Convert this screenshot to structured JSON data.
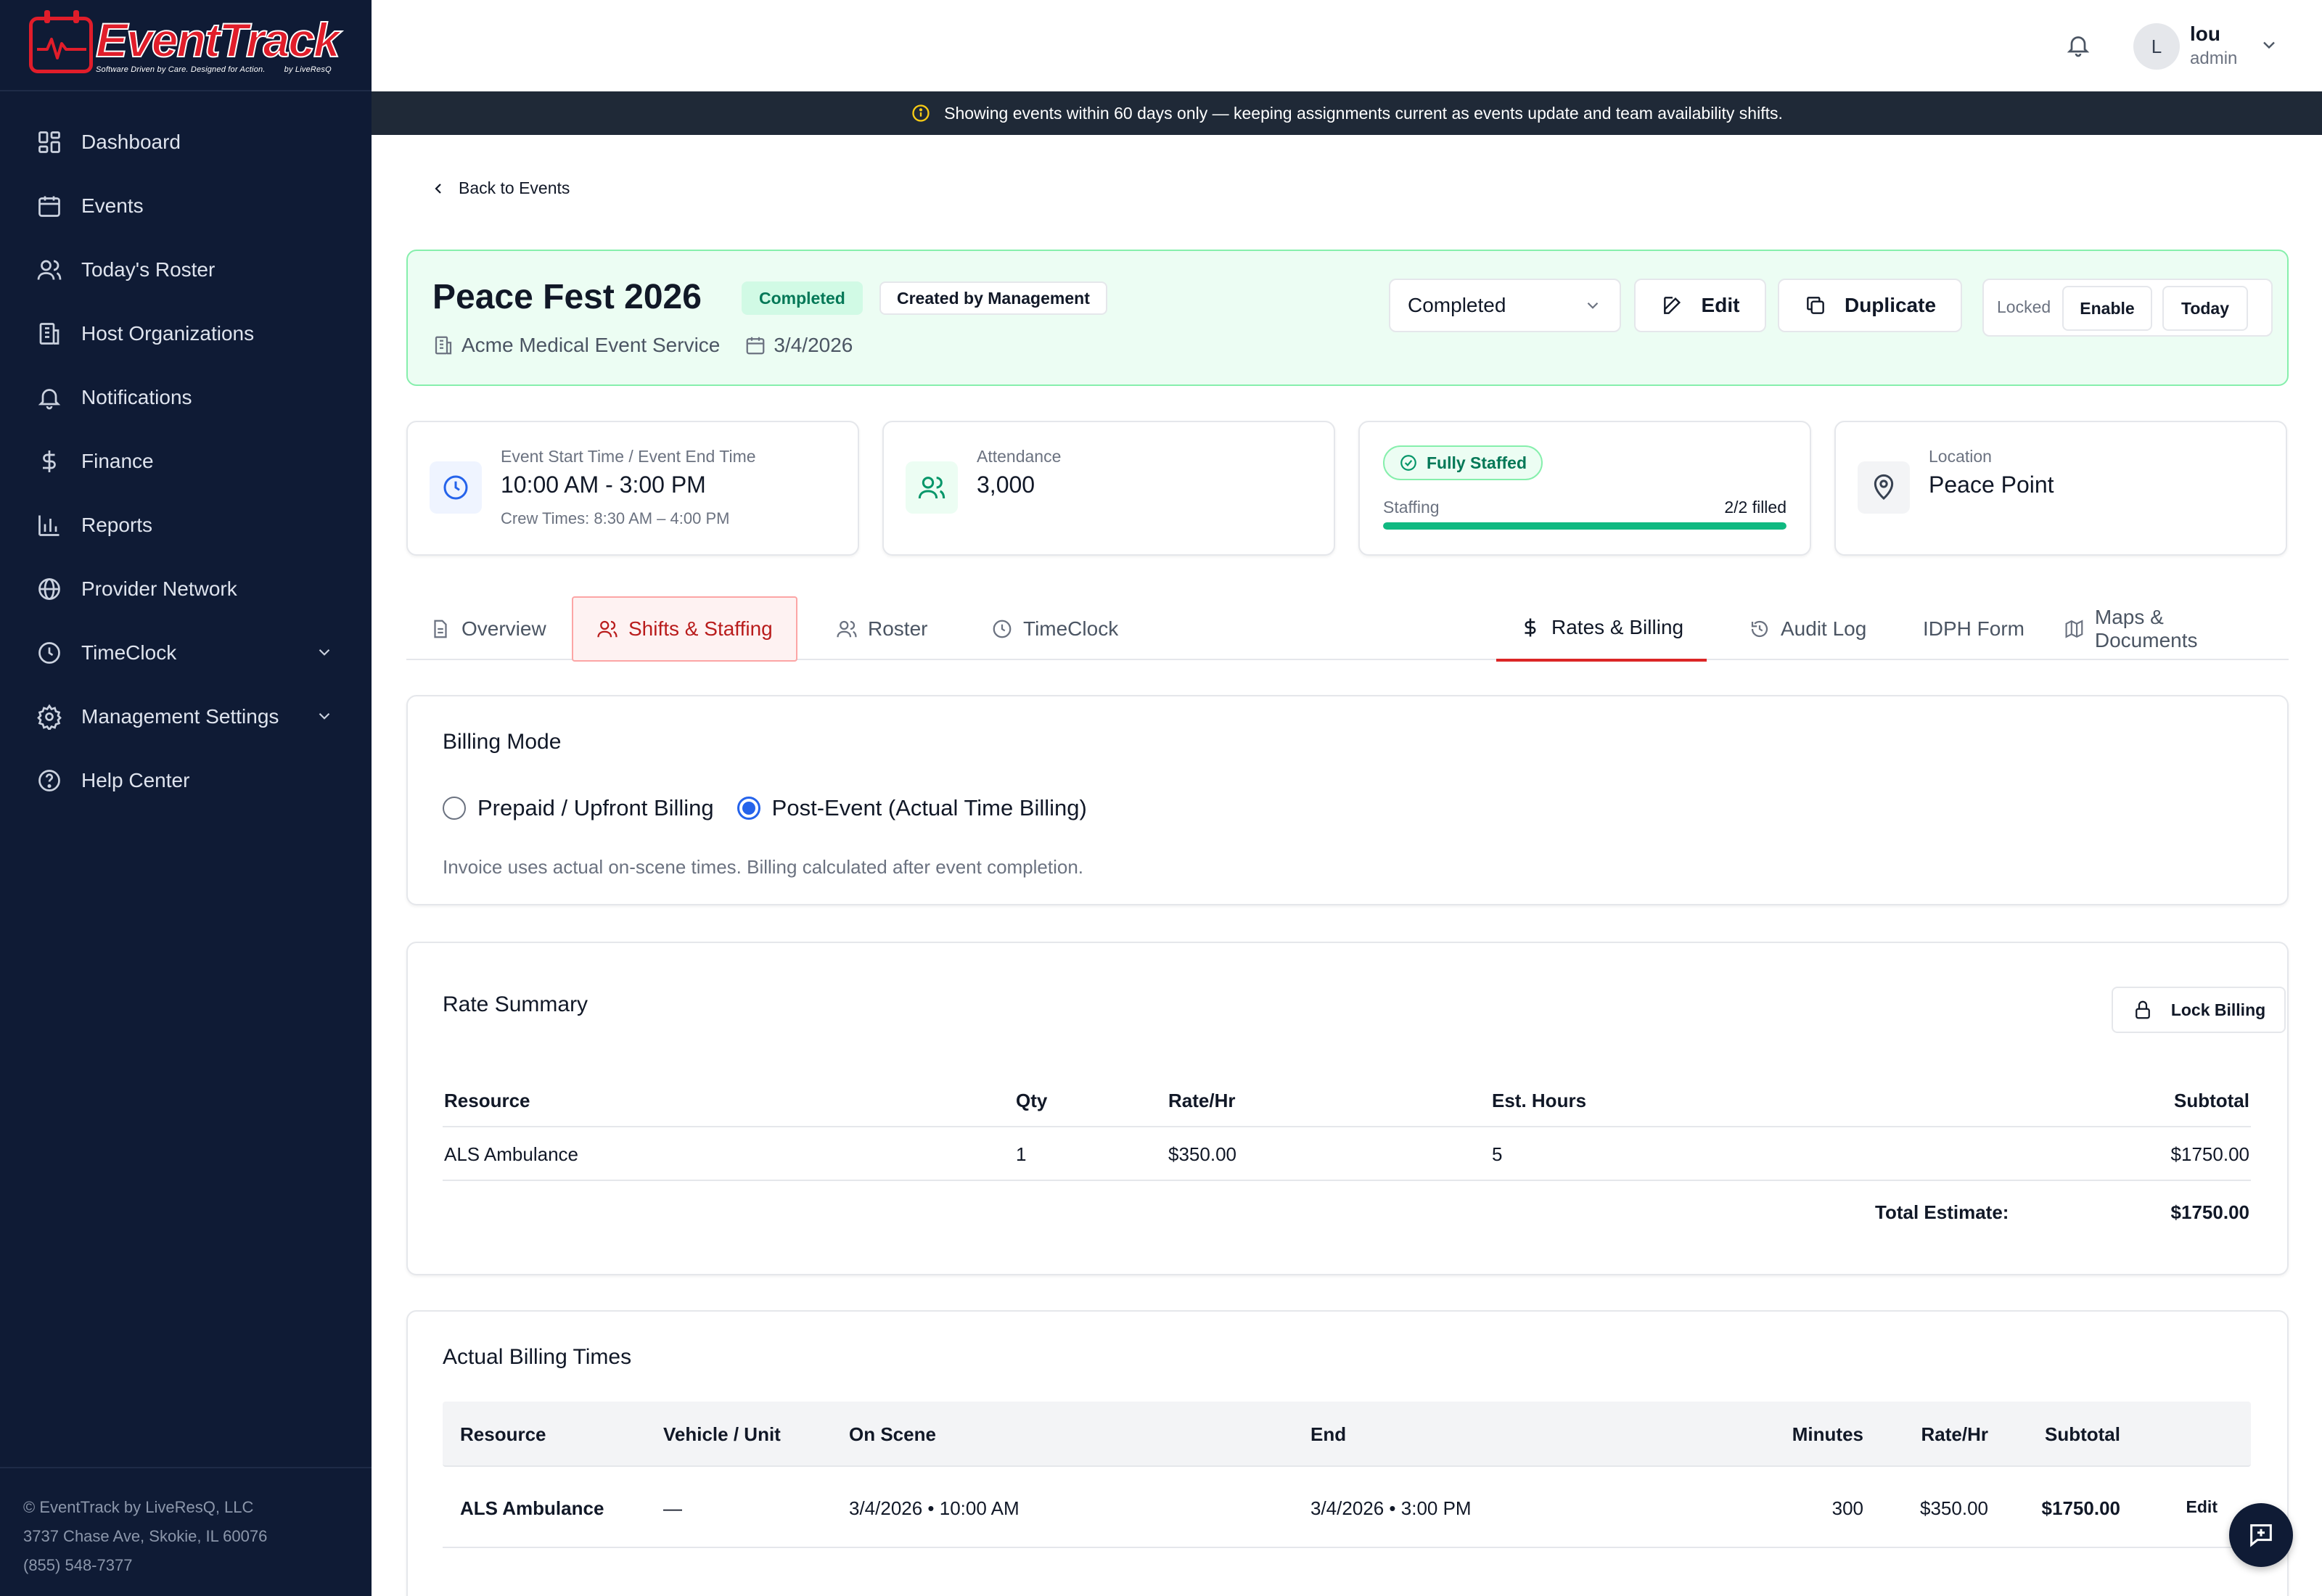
{
  "brand": {
    "name": "EventTrack",
    "tagline": "Software Driven by Care. Designed for Action.",
    "byline": "by LiveResQ",
    "accent": "#e11d2a"
  },
  "sidebar": {
    "items": [
      {
        "label": "Dashboard",
        "icon": "dashboard-icon"
      },
      {
        "label": "Events",
        "icon": "calendar-icon"
      },
      {
        "label": "Today's Roster",
        "icon": "users-icon"
      },
      {
        "label": "Host Organizations",
        "icon": "building-icon"
      },
      {
        "label": "Notifications",
        "icon": "bell-icon"
      },
      {
        "label": "Finance",
        "icon": "dollar-icon"
      },
      {
        "label": "Reports",
        "icon": "bar-chart-icon"
      },
      {
        "label": "Provider Network",
        "icon": "globe-icon"
      },
      {
        "label": "TimeClock",
        "icon": "clock-icon"
      },
      {
        "label": "Management Settings",
        "icon": "gear-icon"
      },
      {
        "label": "Help Center",
        "icon": "help-circle-icon"
      }
    ],
    "footer": {
      "copyright": "© EventTrack by LiveResQ, LLC",
      "address": "3737 Chase Ave, Skokie, IL 60076",
      "phone": "(855) 548-7377"
    }
  },
  "header": {
    "user": {
      "initial": "L",
      "name": "lou",
      "role": "admin"
    }
  },
  "banner": {
    "text": "Showing events within 60 days only — keeping assignments current as events update and team availability shifts."
  },
  "event": {
    "back_label": "Back to Events",
    "title": "Peace Fest 2026",
    "status_badge": "Completed",
    "created_badge": "Created by Management",
    "organization": "Acme Medical Event Service",
    "date": "3/4/2026",
    "status_select": "Completed",
    "edit_label": "Edit",
    "duplicate_label": "Duplicate",
    "locked_label": "Locked",
    "enable_label": "Enable",
    "today_label": "Today"
  },
  "info_cards": {
    "time": {
      "label": "Event Start Time / Event End Time",
      "value": "10:00 AM - 3:00 PM",
      "sub": "Crew Times: 8:30 AM – 4:00 PM"
    },
    "attendance": {
      "label": "Attendance",
      "value": "3,000"
    },
    "staffing": {
      "badge": "Fully Staffed",
      "label": "Staffing",
      "filled": "2/2 filled",
      "fraction": 1.0
    },
    "location": {
      "label": "Location",
      "value": "Peace Point"
    }
  },
  "tabs": [
    {
      "label": "Overview",
      "icon": "document-icon"
    },
    {
      "label": "Shifts & Staffing",
      "icon": "users-icon"
    },
    {
      "label": "Roster",
      "icon": "users-icon"
    },
    {
      "label": "TimeClock",
      "icon": "clock-icon"
    },
    {
      "label": "Rates & Billing",
      "icon": "dollar-icon"
    },
    {
      "label": "Audit Log",
      "icon": "history-icon"
    },
    {
      "label": "IDPH Form",
      "icon": ""
    },
    {
      "label": "Maps & Documents",
      "icon": "map-icon"
    }
  ],
  "billing_mode": {
    "title": "Billing Mode",
    "options": [
      "Prepaid / Upfront Billing",
      "Post-Event (Actual Time Billing)"
    ],
    "selected": "Post-Event (Actual Time Billing)",
    "note": "Invoice uses actual on-scene times. Billing calculated after event completion."
  },
  "rate_summary": {
    "title": "Rate Summary",
    "lock_label": "Lock Billing",
    "headers": [
      "Resource",
      "Qty",
      "Rate/Hr",
      "Est. Hours",
      "Subtotal"
    ],
    "rows": [
      {
        "resource": "ALS Ambulance",
        "qty": "1",
        "rate": "$350.00",
        "hours": "5",
        "subtotal": "$1750.00"
      }
    ],
    "total_label": "Total Estimate:",
    "total_value": "$1750.00"
  },
  "actual_billing": {
    "title": "Actual Billing Times",
    "headers": [
      "Resource",
      "Vehicle / Unit",
      "On Scene",
      "End",
      "Minutes",
      "Rate/Hr",
      "Subtotal"
    ],
    "rows": [
      {
        "resource": "ALS Ambulance",
        "vehicle": "—",
        "on_scene": "3/4/2026 • 10:00 AM",
        "end": "3/4/2026 • 3:00 PM",
        "minutes": "300",
        "rate": "$350.00",
        "subtotal": "$1750.00",
        "action": "Edit"
      }
    ]
  }
}
